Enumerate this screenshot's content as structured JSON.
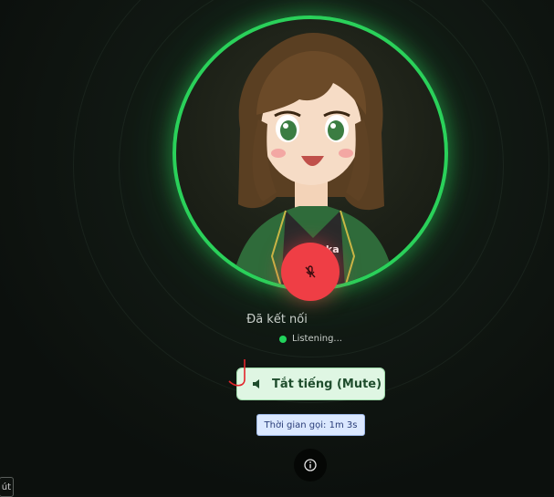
{
  "call": {
    "status": "Đã kết nối",
    "listening": "Listening...",
    "mute_label": "Tắt tiếng (Mute)",
    "timer": "Thời gian gọi: 1m 3s",
    "shirt_text": "Inka"
  },
  "corner_tab": {
    "text": "út"
  },
  "colors": {
    "accent_green": "#2ad15a",
    "mic_red": "#ef3e45",
    "mute_bg": "#dff6e3",
    "timer_bg": "#dbe8ff"
  },
  "icons": {
    "mic": "mic-off-icon",
    "mute": "speaker-icon",
    "info": "info-icon"
  }
}
